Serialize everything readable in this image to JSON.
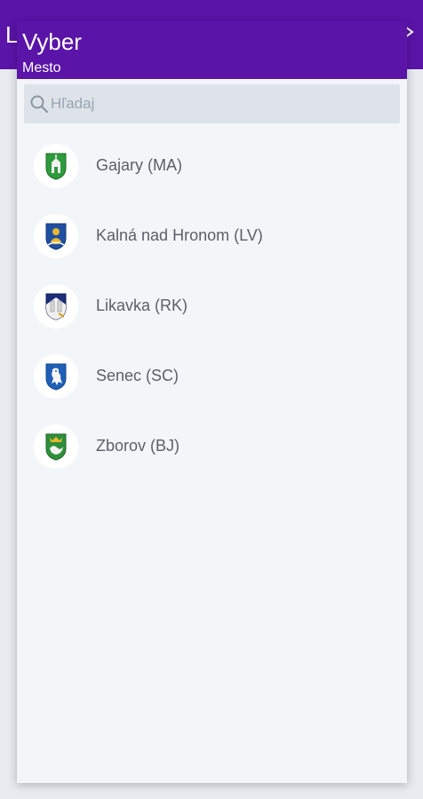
{
  "background_app": {
    "title_fragment": "L"
  },
  "dialog": {
    "title": "Vyber",
    "subtitle": "Mesto",
    "search": {
      "placeholder": "Hľadaj",
      "value": ""
    },
    "items": [
      {
        "label": "Gajary (MA)",
        "crest_icon": "gajary-crest-icon"
      },
      {
        "label": "Kalná nad Hronom (LV)",
        "crest_icon": "kalna-crest-icon"
      },
      {
        "label": "Likavka (RK)",
        "crest_icon": "likavka-crest-icon"
      },
      {
        "label": "Senec (SC)",
        "crest_icon": "senec-crest-icon"
      },
      {
        "label": "Zborov (BJ)",
        "crest_icon": "zborov-crest-icon"
      }
    ]
  },
  "colors": {
    "header": "#5a14a8",
    "dialog_bg": "#f3f6f9",
    "search_bg": "#dde3e9",
    "text": "#5b6066"
  }
}
